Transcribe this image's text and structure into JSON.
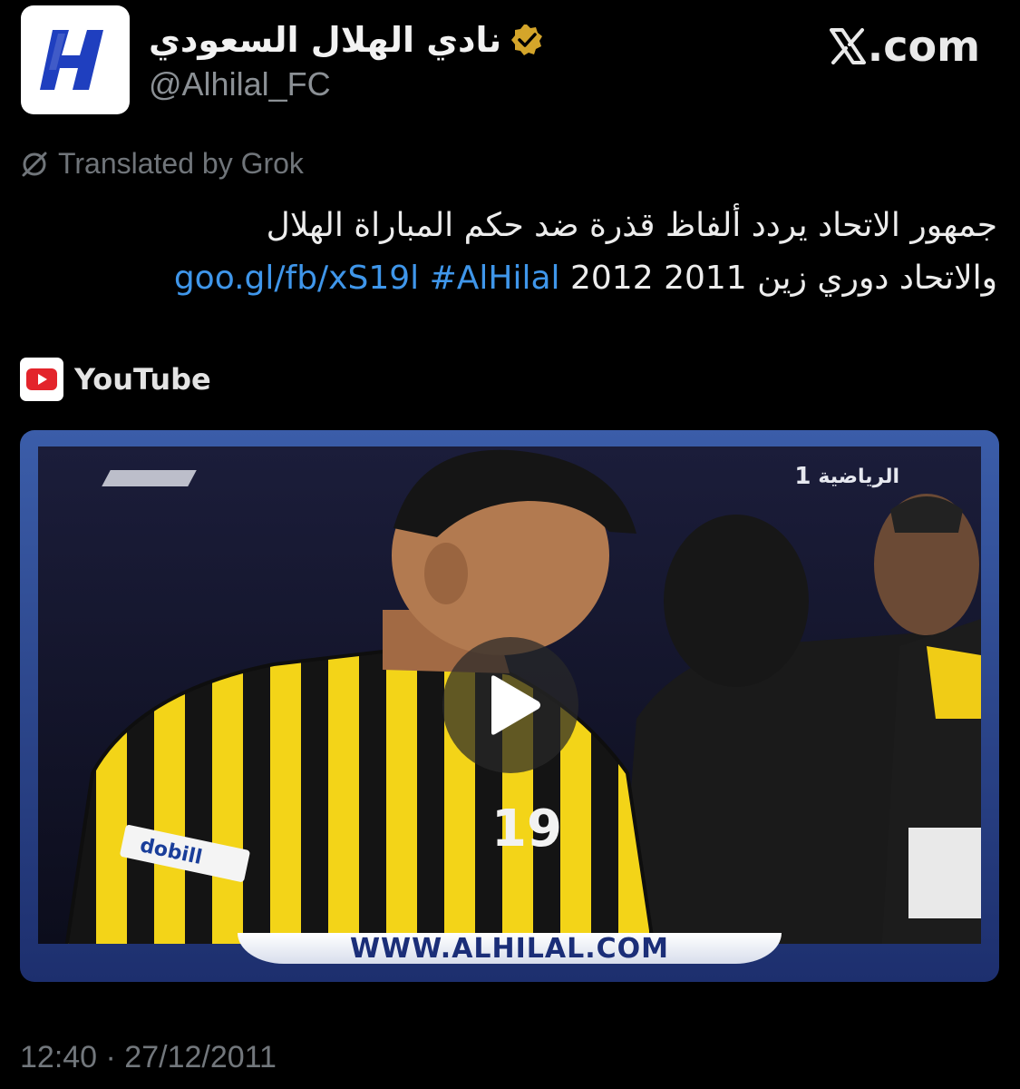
{
  "header": {
    "display_name": "نادي الهلال السعودي",
    "handle": "@Alhilal_FC",
    "site_label": ".com",
    "verified_badge_color": "#d4a52a"
  },
  "translation_note": "Translated by Grok",
  "tweet": {
    "text_line1": "جمهور الاتحاد يردد ألفاظ قذرة ضد حكم المباراة الهلال",
    "text_line2_plain": "والاتحاد دوري زين 2011 2012",
    "link_text": "goo.gl/fb/xS19l",
    "hashtag": "#AlHilal",
    "link_color": "#3f96ea"
  },
  "source": {
    "name": "YouTube",
    "icon": "youtube-icon"
  },
  "video": {
    "watermark_url": "WWW.ALHILAL.COM",
    "channel_logo_text": "الرياضية",
    "channel_number": "1",
    "sponsor_text": "dobill",
    "shirt_number": "19",
    "play_icon": "play-icon"
  },
  "timestamp": "12:40 · 27/12/2011"
}
